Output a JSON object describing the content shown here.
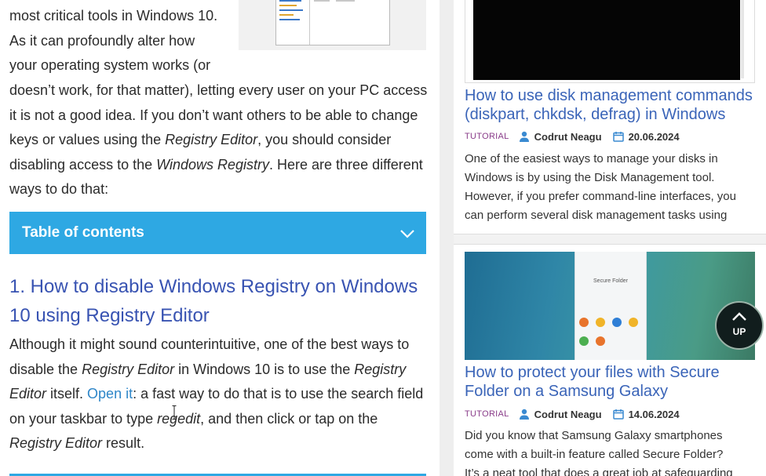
{
  "article": {
    "intro_lines_narrow": [
      "most critical tools in Windows 10.",
      "As it can profoundly alter how",
      "your operating system works (or"
    ],
    "intro_lines_wide": [
      {
        "a": "doesn’t work, for that matter), letting every user on your PC access"
      },
      {
        "a": "it is not a good idea. If you don’t want others to be able to change"
      },
      {
        "a": "keys or values using the ",
        "i": "Registry Editor",
        "b": ", you should consider"
      },
      {
        "a": "disabling access to the ",
        "i": "Windows Registry",
        "b": ". Here are three different"
      },
      {
        "a": "ways to do that:"
      }
    ],
    "toc_title": "Table of contents",
    "heading": "1. How to disable Windows Registry on Windows 10 using Registry Editor",
    "body": {
      "l1": "Although it might sound counterintuitive, one of the best ways to",
      "l2a": "disable the ",
      "l2i": "Registry Editor",
      "l2b": " in Windows 10 is to use the ",
      "l2i2": "Registry",
      "l3i": "Editor",
      "l3a": " itself. ",
      "l3link": "Open it",
      "l3b": ": a fast way to do that is to use the search field",
      "l4a": "on your taskbar to type ",
      "l4i": "regedit",
      "l4b": ", and then click or tap on the",
      "l5i": "Registry Editor",
      "l5a": " result."
    }
  },
  "sidebar": {
    "card1": {
      "title": "How to use disk management commands (diskpart, chkdsk, defrag) in Windows",
      "category": "TUTORIAL",
      "author": "Codrut Neagu",
      "date": "20.06.2024",
      "excerpt_lines": [
        "One of the easiest ways to manage your disks in",
        "Windows is by using the Disk Management tool.",
        "However, if you prefer command-line interfaces, you",
        "can perform several disk management tasks using"
      ]
    },
    "card2": {
      "image_text": "Secure Folder",
      "title": "How to protect your files with Secure Folder on a Samsung Galaxy",
      "category": "TUTORIAL",
      "author": "Codrut Neagu",
      "date": "14.06.2024",
      "excerpt_lines": [
        "Did you know that Samsung Galaxy smartphones",
        "come with a built-in feature called Secure Folder?",
        "It’s a neat tool that does a great job at safeguarding"
      ]
    }
  },
  "up_button": {
    "label": "UP"
  },
  "colors": {
    "accent_blue": "#2ea8e3",
    "heading_blue": "#3853b2",
    "link_blue": "#3a64b8",
    "category_purple": "#8a3d8a"
  }
}
